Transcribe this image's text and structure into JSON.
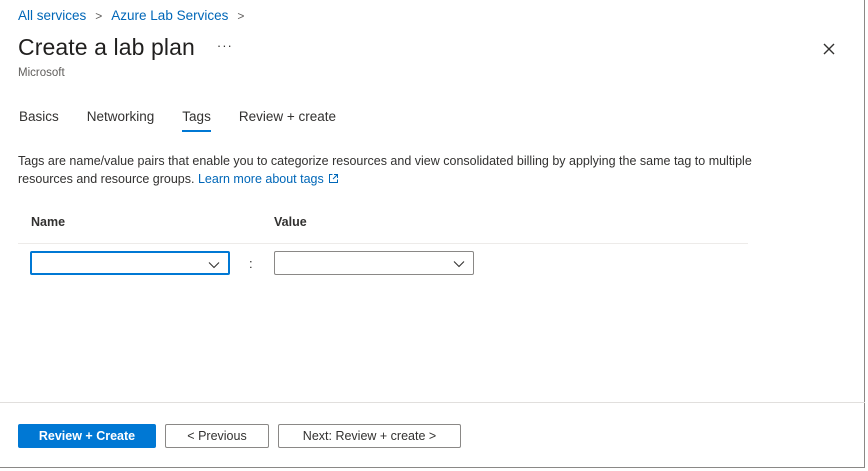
{
  "breadcrumb": {
    "items": [
      "All services",
      "Azure Lab Services"
    ],
    "separator": ">"
  },
  "header": {
    "title": "Create a lab plan",
    "more_label": "···",
    "subtitle": "Microsoft"
  },
  "tabs": [
    {
      "label": "Basics",
      "active": false
    },
    {
      "label": "Networking",
      "active": false
    },
    {
      "label": "Tags",
      "active": true
    },
    {
      "label": "Review + create",
      "active": false
    }
  ],
  "description": {
    "text": "Tags are name/value pairs that enable you to categorize resources and view consolidated billing by applying the same tag to multiple resources and resource groups.",
    "link_text": "Learn more about tags"
  },
  "tags_table": {
    "columns": [
      "Name",
      "Value"
    ],
    "rows": [
      {
        "name": "",
        "separator": ":",
        "value": ""
      }
    ]
  },
  "footer": {
    "review_create_label": "Review + Create",
    "previous_label": "< Previous",
    "next_label": "Next: Review + create >"
  },
  "colors": {
    "accent": "#0078d4",
    "link": "#0067b8",
    "text": "#323130",
    "border": "#8a8886"
  },
  "icons": [
    "chevron-right-icon",
    "more-icon",
    "close-icon",
    "external-link-icon",
    "chevron-down-icon"
  ]
}
